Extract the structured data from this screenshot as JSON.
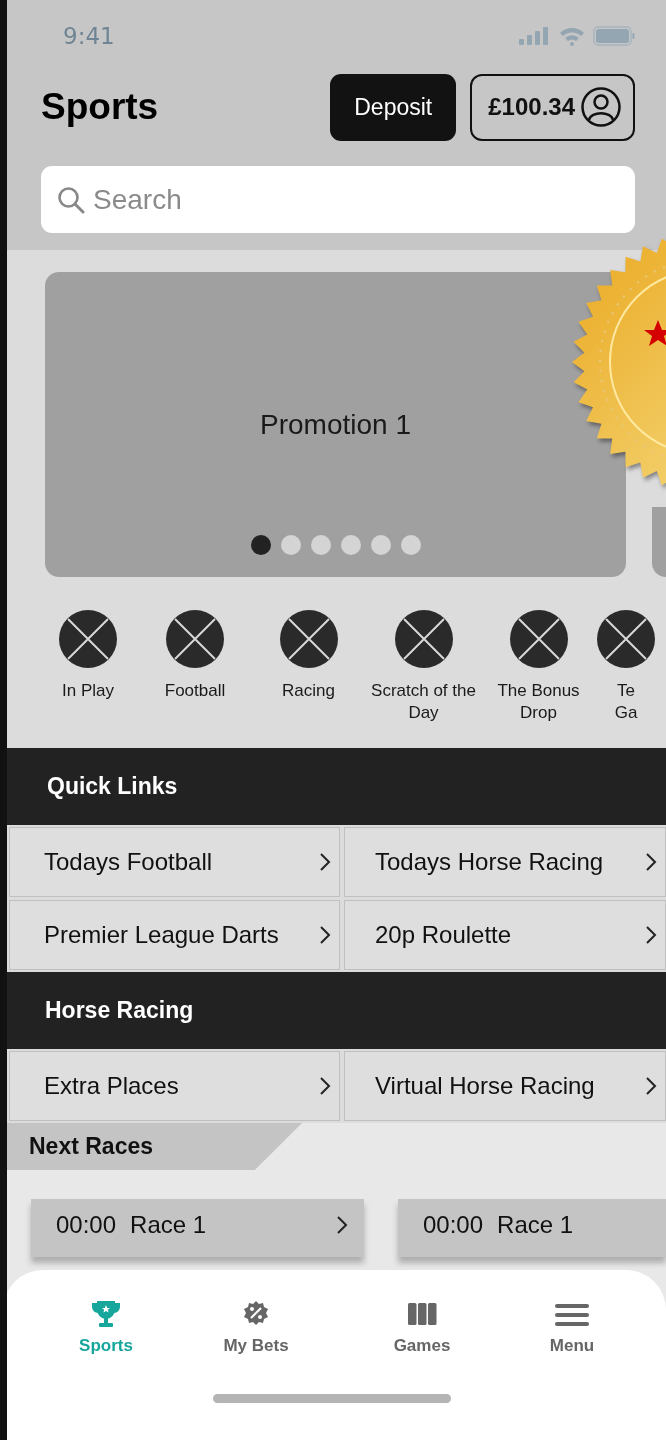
{
  "status_bar": {
    "time": "9:41"
  },
  "header": {
    "title": "Sports",
    "deposit_button": "Deposit",
    "balance": "£100.34"
  },
  "search": {
    "placeholder": "Search"
  },
  "promotions": {
    "title": "Promotion 1",
    "dots": [
      {
        "selected": true
      },
      {
        "selected": false
      },
      {
        "selected": false
      },
      {
        "selected": false
      },
      {
        "selected": false
      },
      {
        "selected": false
      }
    ]
  },
  "categories": [
    {
      "label": "In Play"
    },
    {
      "label": "Football"
    },
    {
      "label": "Racing"
    },
    {
      "label": "Scratch of the Day"
    },
    {
      "label": "The Bonus Drop"
    },
    {
      "label": "Te Ga"
    }
  ],
  "quick_links": {
    "title": "Quick Links",
    "links": [
      "Todays Football",
      "Todays Horse Racing",
      "Premier League Darts",
      "20p Roulette"
    ]
  },
  "horse_racing": {
    "title": "Horse Racing",
    "links": [
      "Extra Places",
      "Virtual Horse Racing"
    ]
  },
  "next_races": {
    "title": "Next Races",
    "races": [
      {
        "time": "00:00",
        "name": "Race 1",
        "chevron": true
      },
      {
        "time": "00:00",
        "name": "Race 1",
        "chevron": false
      }
    ]
  },
  "bottom_nav": [
    {
      "label": "Sports",
      "kind": "trophy",
      "selected": true
    },
    {
      "label": "My Bets",
      "kind": "bets",
      "selected": false
    },
    {
      "label": "Games",
      "kind": "slots",
      "selected": false
    },
    {
      "label": "Menu",
      "kind": "menu",
      "selected": false
    }
  ]
}
